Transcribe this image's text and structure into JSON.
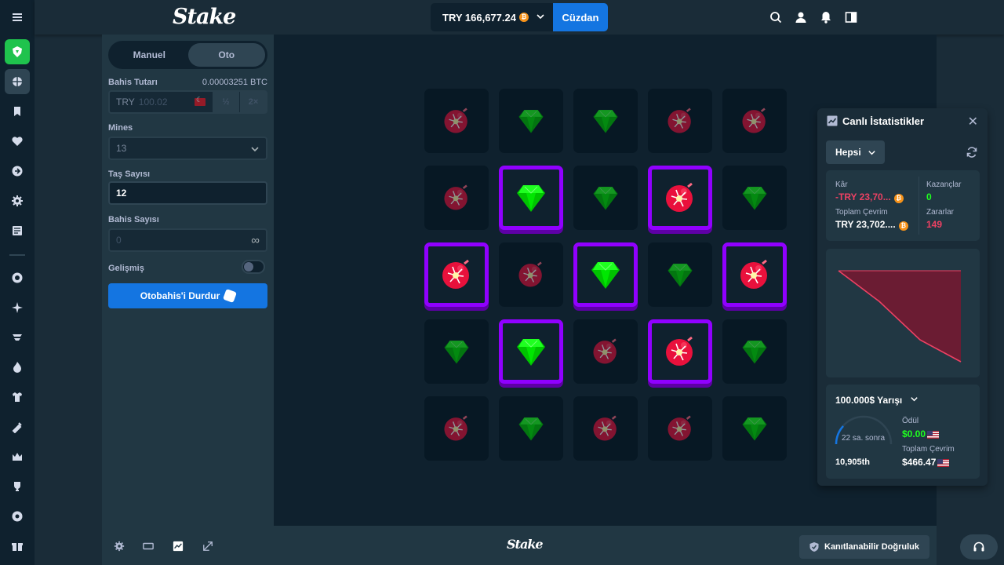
{
  "header": {
    "logo": "Stake",
    "balance": "TRY 166,677.24",
    "coin_symbol": "₿",
    "wallet_label": "Cüzdan",
    "icons": [
      "search-icon",
      "user-icon",
      "bell-icon",
      "sidebar-toggle-icon"
    ]
  },
  "sidebar": {
    "icons": [
      "menu-icon",
      "stake-originals-icon",
      "sports-icon",
      "bookmark-icon",
      "heart-icon",
      "arrow-right-circle-icon",
      "gear-icon",
      "news-icon",
      "poker-chip-icon",
      "sparkle-icon",
      "tennis-icon",
      "flame-icon",
      "shirt-icon",
      "syringe-icon",
      "crown-icon",
      "trophy-icon",
      "shield-icon",
      "gift-icon"
    ]
  },
  "controls": {
    "tab_manual": "Manuel",
    "tab_auto": "Oto",
    "bet_amount_label": "Bahis Tutarı",
    "bet_amount_btc": "0.00003251 BTC",
    "bet_currency": "TRY",
    "bet_amount_value": "100.02",
    "half_label": "½",
    "double_label": "2×",
    "mines_label": "Mines",
    "mines_value": "13",
    "gems_label": "Taş Sayısı",
    "gems_value": "12",
    "bets_label": "Bahis Sayısı",
    "bets_value": "0",
    "infinity": "∞",
    "advanced_label": "Gelişmiş",
    "advanced_on": false,
    "stop_autobet_label": "Otobahis'i Durdur"
  },
  "board": {
    "rows": 5,
    "cols": 5,
    "tiles": [
      {
        "type": "mine",
        "state": "dim"
      },
      {
        "type": "gem",
        "state": "dim"
      },
      {
        "type": "gem",
        "state": "dim"
      },
      {
        "type": "mine",
        "state": "dim"
      },
      {
        "type": "mine",
        "state": "dim"
      },
      {
        "type": "mine",
        "state": "dim"
      },
      {
        "type": "gem",
        "state": "selected"
      },
      {
        "type": "gem",
        "state": "dim"
      },
      {
        "type": "mine",
        "state": "selected"
      },
      {
        "type": "gem",
        "state": "dim"
      },
      {
        "type": "mine",
        "state": "selected"
      },
      {
        "type": "mine",
        "state": "dim"
      },
      {
        "type": "gem",
        "state": "selected"
      },
      {
        "type": "gem",
        "state": "dim"
      },
      {
        "type": "mine",
        "state": "selected"
      },
      {
        "type": "gem",
        "state": "dim"
      },
      {
        "type": "gem",
        "state": "selected"
      },
      {
        "type": "mine",
        "state": "dim"
      },
      {
        "type": "mine",
        "state": "selected"
      },
      {
        "type": "gem",
        "state": "dim"
      },
      {
        "type": "mine",
        "state": "dim"
      },
      {
        "type": "gem",
        "state": "dim"
      },
      {
        "type": "mine",
        "state": "dim"
      },
      {
        "type": "mine",
        "state": "dim"
      },
      {
        "type": "gem",
        "state": "dim"
      }
    ]
  },
  "stats": {
    "title": "Canlı İstatistikler",
    "close": "✕",
    "filter": "Hepsi",
    "profit_label": "Kâr",
    "profit_value": "-TRY 23,70...",
    "wagered_label": "Toplam Çevrim",
    "wagered_value": "TRY 23,702....",
    "wins_label": "Kazançlar",
    "wins_value": "0",
    "losses_label": "Zararlar",
    "losses_value": "149",
    "race_title": "100.000$ Yarışı",
    "race_time": "22 sa. sonra",
    "race_rank": "10,905th",
    "prize_label": "Ödül",
    "prize_value": "$0.00",
    "race_wagered_label": "Toplam Çevrim",
    "race_wagered_value": "$466.47"
  },
  "chart_data": {
    "type": "area",
    "x": [
      0,
      1,
      2,
      3
    ],
    "series": [
      {
        "values": [
          0,
          -8000,
          -18000,
          -23702
        ]
      }
    ],
    "grid": false,
    "colors": {
      "line": "#ed4163",
      "fill": "#6b1c33"
    }
  },
  "footer": {
    "logo": "Stake",
    "fairness_label": "Kanıtlanabilir Doğruluk",
    "icons": [
      "gear-icon",
      "theatre-mode-icon",
      "stats-icon",
      "popout-icon"
    ]
  },
  "colors": {
    "accent": "#1475e1",
    "mine_red": "#e9113c",
    "gem_green": "#00e701",
    "selected_border": "#9000ff",
    "loss_pink": "#ed4163",
    "win_green": "#1fff20"
  }
}
